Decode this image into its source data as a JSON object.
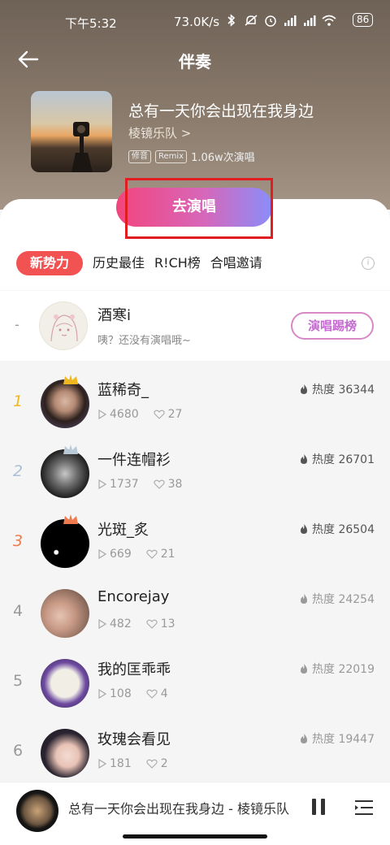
{
  "status_bar": {
    "time": "下午5:32",
    "speed": "73.0K/s",
    "battery": "86"
  },
  "header": {
    "title": "伴奏"
  },
  "song": {
    "title": "总有一天你会出现在我身边",
    "artist": "棱镜乐队 >",
    "tags": [
      "修音",
      "Remix"
    ],
    "play_count": "1.06w次演唱"
  },
  "sing_button": "去演唱",
  "tabs": [
    {
      "label": "新势力",
      "active": true
    },
    {
      "label": "历史最佳",
      "active": false
    },
    {
      "label": "R!CH榜",
      "active": false
    },
    {
      "label": "合唱邀请",
      "active": false
    }
  ],
  "info_icon": "i",
  "self_entry": {
    "rank": "-",
    "name": "酒寒i",
    "subtitle": "咦？还没有演唱哦~",
    "button": "演唱踢榜"
  },
  "ranking": [
    {
      "rank": "1",
      "name": "蓝稀奇_",
      "plays": "4680",
      "likes": "27",
      "heat": "热度 36344"
    },
    {
      "rank": "2",
      "name": "一件连帽衫",
      "plays": "1737",
      "likes": "38",
      "heat": "热度 26701"
    },
    {
      "rank": "3",
      "name": "光斑_炙",
      "plays": "669",
      "likes": "21",
      "heat": "热度 26504"
    },
    {
      "rank": "4",
      "name": "Encorejay",
      "plays": "482",
      "likes": "13",
      "heat": "热度 24254"
    },
    {
      "rank": "5",
      "name": "我的匡乖乖",
      "plays": "108",
      "likes": "4",
      "heat": "热度 22019"
    },
    {
      "rank": "6",
      "name": "玫瑰会看见",
      "plays": "181",
      "likes": "2",
      "heat": "热度 19447"
    }
  ],
  "player": {
    "title": "总有一天你会出现在我身边 - 棱镜乐队"
  },
  "colors": {
    "accent_red": "#f25252",
    "gold": "#f0b81e",
    "silver": "#a9c0d6",
    "bronze": "#ee7a4d"
  }
}
